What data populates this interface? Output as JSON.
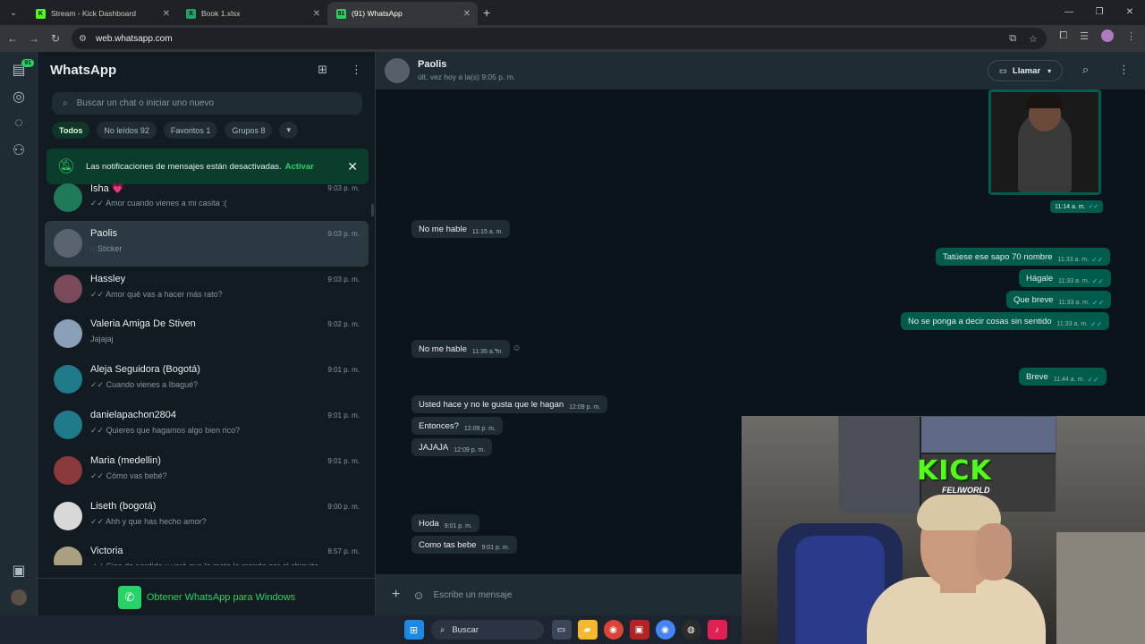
{
  "browser": {
    "tabs": [
      {
        "title": "Stream - Kick Dashboard",
        "color": "#53fc18",
        "glyph": "K",
        "active": false
      },
      {
        "title": "Book 1.xlsx",
        "color": "#21a366",
        "glyph": "X",
        "active": false
      },
      {
        "title": "(91) WhatsApp",
        "color": "#25d366",
        "glyph": "91",
        "active": true
      }
    ],
    "url": "web.whatsapp.com"
  },
  "rail": {
    "badge": "91"
  },
  "sidebar": {
    "title": "WhatsApp",
    "search_placeholder": "Buscar un chat o iniciar uno nuevo",
    "filters": [
      "Todos",
      "No leídos 92",
      "Favoritos 1",
      "Grupos 8"
    ],
    "notification": {
      "text": "Las notificaciones de mensajes están desactivadas.",
      "action": "Activar"
    },
    "chats": [
      {
        "name": "Isha 💗",
        "time": "9:03 p. m.",
        "preview": "✓✓ Amor cuando vienes a mi casita :(",
        "avatar_color": "#1f7a5a"
      },
      {
        "name": "Paolis",
        "time": "9:03 p. m.",
        "preview": "◌ Sticker",
        "avatar_color": "#5a6470",
        "selected": true
      },
      {
        "name": "Hassley",
        "time": "9:03 p. m.",
        "preview": "✓✓ Amor qué vas a hacer más rato?",
        "avatar_color": "#7a4a5a"
      },
      {
        "name": "Valeria  Amiga De Stiven",
        "time": "9:02 p. m.",
        "preview": "Jajajaj",
        "avatar_color": "#8aa0b8"
      },
      {
        "name": "Aleja Seguidora (Bogotá)",
        "time": "9:01 p. m.",
        "preview": "✓✓ Cuando vienes a Ibagué?",
        "avatar_color": "#1f7a8a"
      },
      {
        "name": "danielapachon2804",
        "time": "9:01 p. m.",
        "preview": "✓✓ Quieres que hagamos algo bien rico?",
        "avatar_color": "#1f7a8a"
      },
      {
        "name": "Maria (medellin)",
        "time": "9:01 p. m.",
        "preview": "✓✓ Cómo vas bebé?",
        "avatar_color": "#8a3a3a"
      },
      {
        "name": "Liseth (bogotá)",
        "time": "9:00 p. m.",
        "preview": "✓✓ Ahh y que has hecho amor?",
        "avatar_color": "#d8d8d8"
      },
      {
        "name": "Victoria",
        "time": "8:57 p. m.",
        "preview": "✓✓ Siga de perdida y verá que le meto la monda por el chiquito",
        "avatar_color": "#a8a080"
      }
    ],
    "get_app": "Obtener WhatsApp para Windows"
  },
  "conversation": {
    "contact": "Paolis",
    "status": "últ. vez hoy a la(s) 9:05 p. m.",
    "call_label": "Llamar",
    "image_time": "11:14 a. m.",
    "messages": [
      {
        "dir": "in",
        "text": "No me hable",
        "time": "11:15 a. m."
      },
      {
        "dir": "out",
        "text": "Tatúese ese sapo 70 nombre",
        "time": "11:33 a. m."
      },
      {
        "dir": "out",
        "text": "Hágale",
        "time": "11:33 a. m."
      },
      {
        "dir": "out",
        "text": "Que breve",
        "time": "11:33 a. m."
      },
      {
        "dir": "out",
        "text": "No se ponga a decir cosas sin sentido",
        "time": "11:33 a. m."
      },
      {
        "dir": "in",
        "text": "No me hable",
        "time": "11:35 a. m."
      },
      {
        "dir": "out",
        "text": "Breve",
        "time": "11:44 a. m."
      },
      {
        "dir": "in",
        "text": "Usted hace y no le gusta que le hagan",
        "time": "12:09 p. m."
      },
      {
        "dir": "in",
        "text": "Entonces?",
        "time": "12:09 p. m."
      },
      {
        "dir": "in",
        "text": "JAJAJA",
        "time": "12:09 p. m."
      },
      {
        "dir": "in",
        "text": "Hoda",
        "time": "9:01 p. m."
      },
      {
        "dir": "in",
        "text": "Como tas bebe",
        "time": "9:01 p. m."
      }
    ],
    "composer_placeholder": "Escribe un mensaje"
  },
  "overlay": {
    "brand": "KICK",
    "handle": "FELIWORLD"
  },
  "taskbar": {
    "search_label": "Buscar"
  }
}
